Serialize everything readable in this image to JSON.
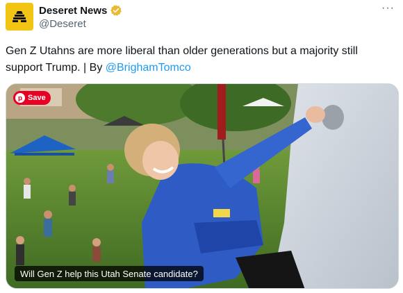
{
  "account": {
    "display_name": "Deseret News",
    "handle": "@Deseret",
    "avatar_icon": "beehive-icon",
    "avatar_color": "#f2c413",
    "verified_color": "#e8b931"
  },
  "more_label": "···",
  "tweet": {
    "text": "Gen Z Utahns are more liberal than older generations but a majority still support Trump. | By ",
    "mention": "@BrighamTomco",
    "mention_color": "#1d9bf0"
  },
  "media": {
    "save_label": "Save",
    "save_color": "#e60023",
    "caption": "Will Gen Z help this Utah Senate candidate?"
  }
}
